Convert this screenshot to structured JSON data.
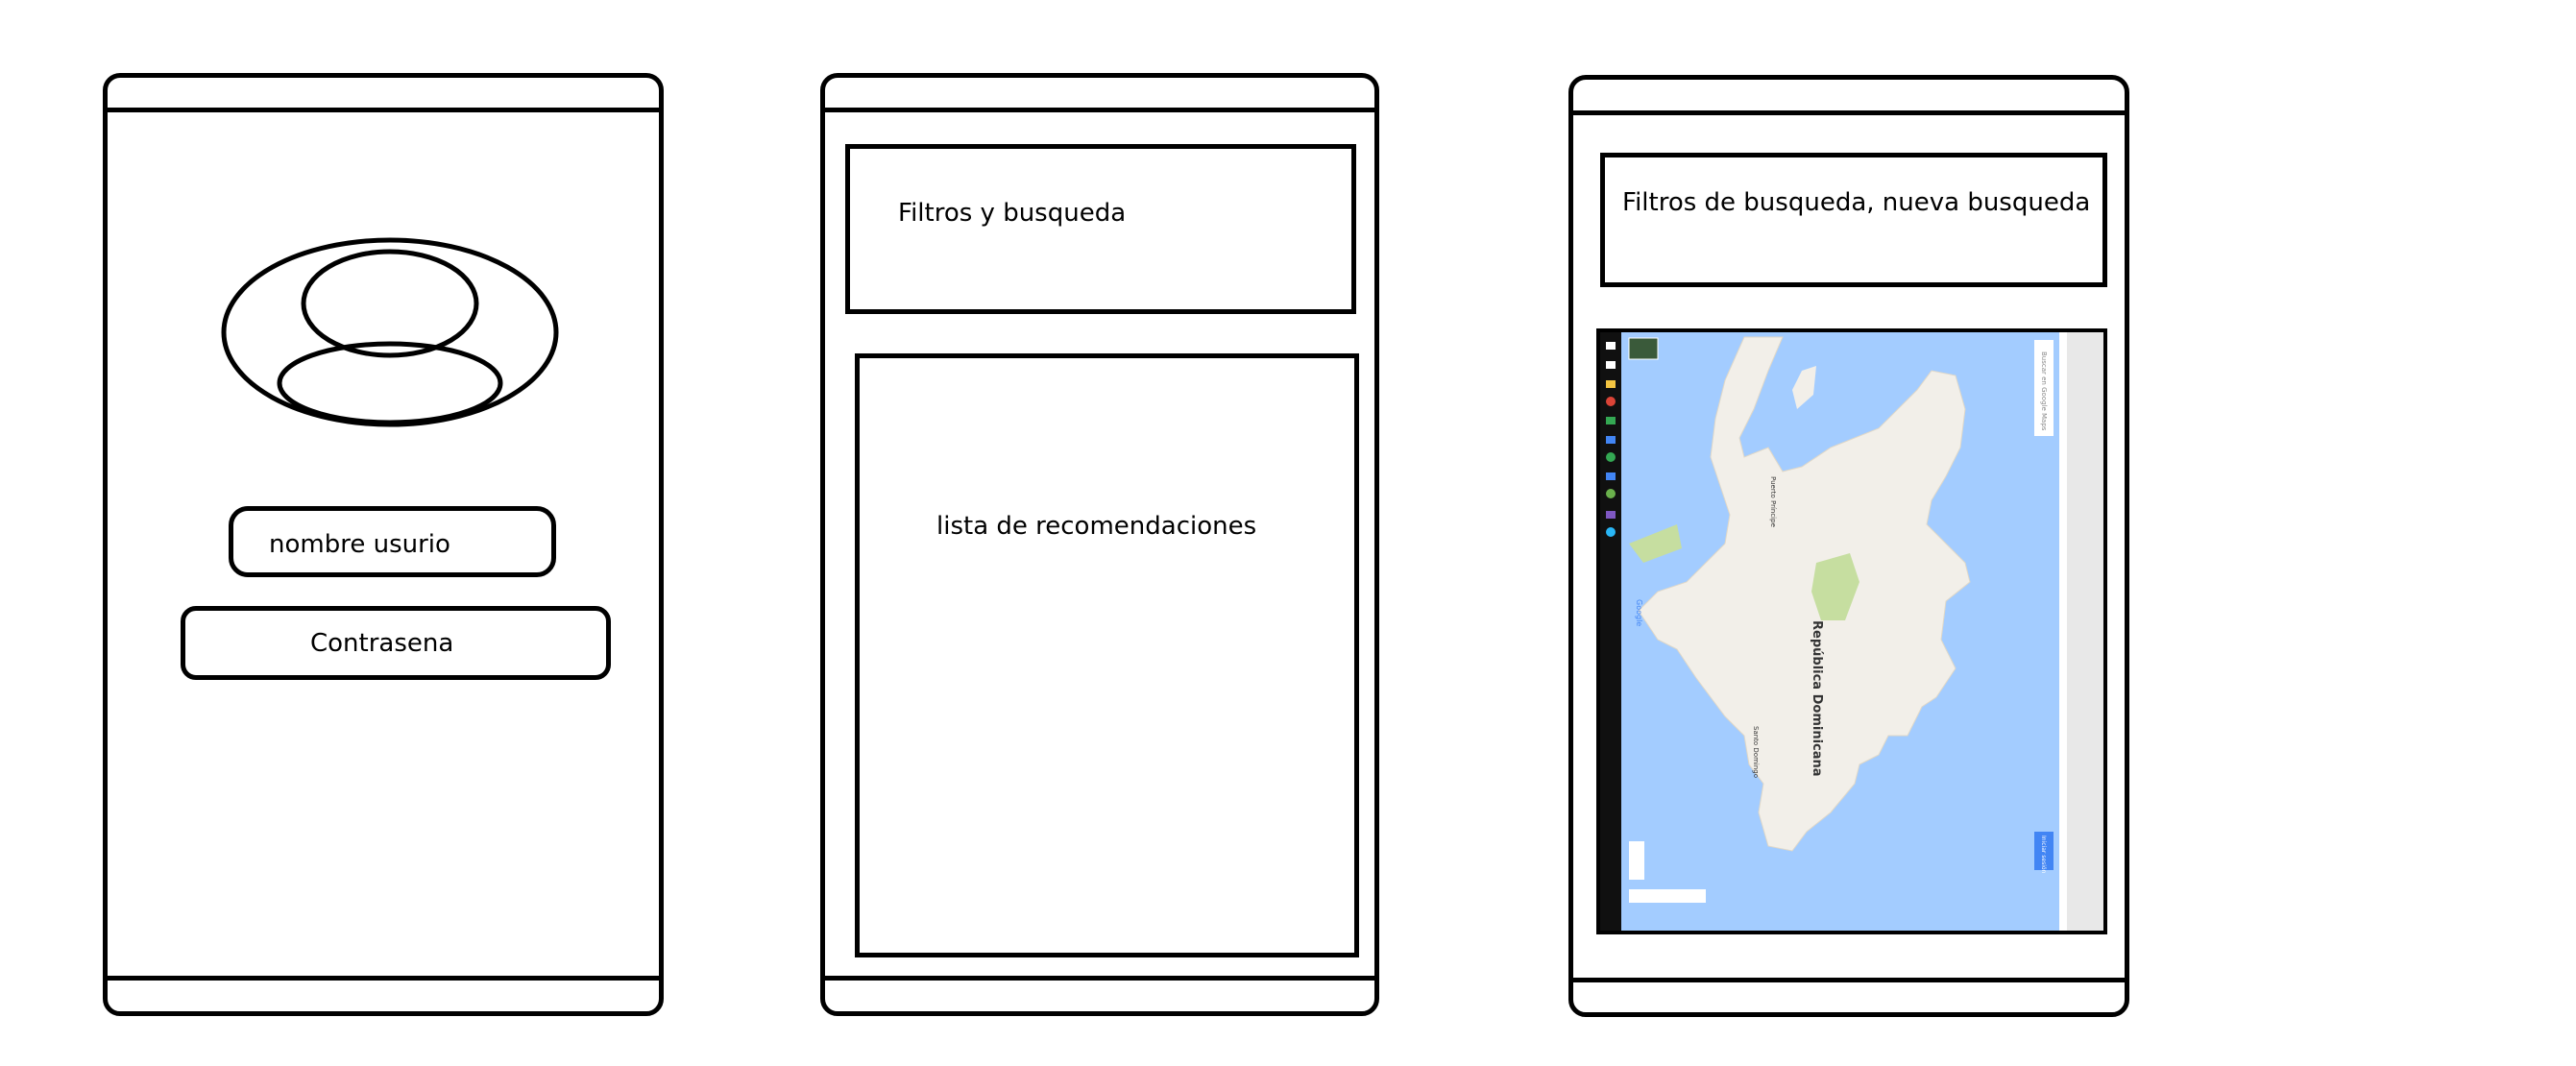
{
  "screens": {
    "login": {
      "username_label": "nombre usurio",
      "password_label": "Contrasena"
    },
    "recommendations": {
      "filters_label": "Filtros y busqueda",
      "list_label": "lista de recomendaciones"
    },
    "map": {
      "filters_label": "Filtros de busqueda, nueva busqueda",
      "map_labels": {
        "country": "República Dominicana",
        "search_placeholder": "Buscar en Google Maps",
        "sign_in": "Iniciar sesión",
        "google_logo": "Google",
        "city_1": "Puerto Príncipe",
        "city_2": "Santo Domingo"
      }
    }
  },
  "colors": {
    "sea": "#a3ccff",
    "land": "#f2efe9",
    "park": "#c6dea0",
    "taskbar": "#101010",
    "accent": "#4285f4"
  }
}
